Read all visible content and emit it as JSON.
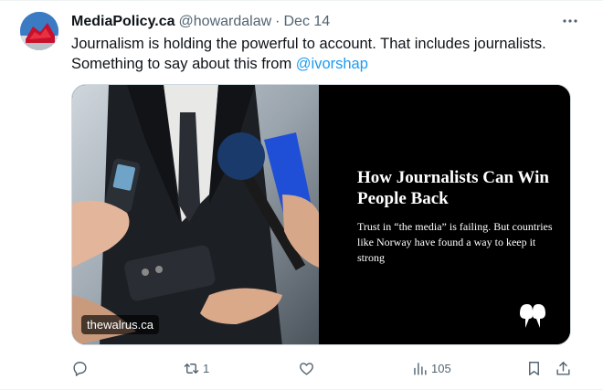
{
  "tweet": {
    "author_name": "MediaPolicy.ca",
    "handle": "@howardalaw",
    "separator": "·",
    "date": "Dec 14",
    "text_part1": "Journalism is holding the powerful to account. That includes journalists. Something to say about this from ",
    "mention": "@ivorshap"
  },
  "card": {
    "title": "How Journalists Can Win People Back",
    "description": "Trust in “the media” is failing. But countries like Norway have found a way to keep it strong",
    "domain": "thewalrus.ca"
  },
  "actions": {
    "reposts": "1",
    "views": "105"
  },
  "colors": {
    "accent": "#1d9bf0",
    "muted": "#536471",
    "text": "#0f1419"
  },
  "icons": [
    "more-icon",
    "reply-icon",
    "repost-icon",
    "like-icon",
    "views-icon",
    "bookmark-icon",
    "share-icon"
  ]
}
